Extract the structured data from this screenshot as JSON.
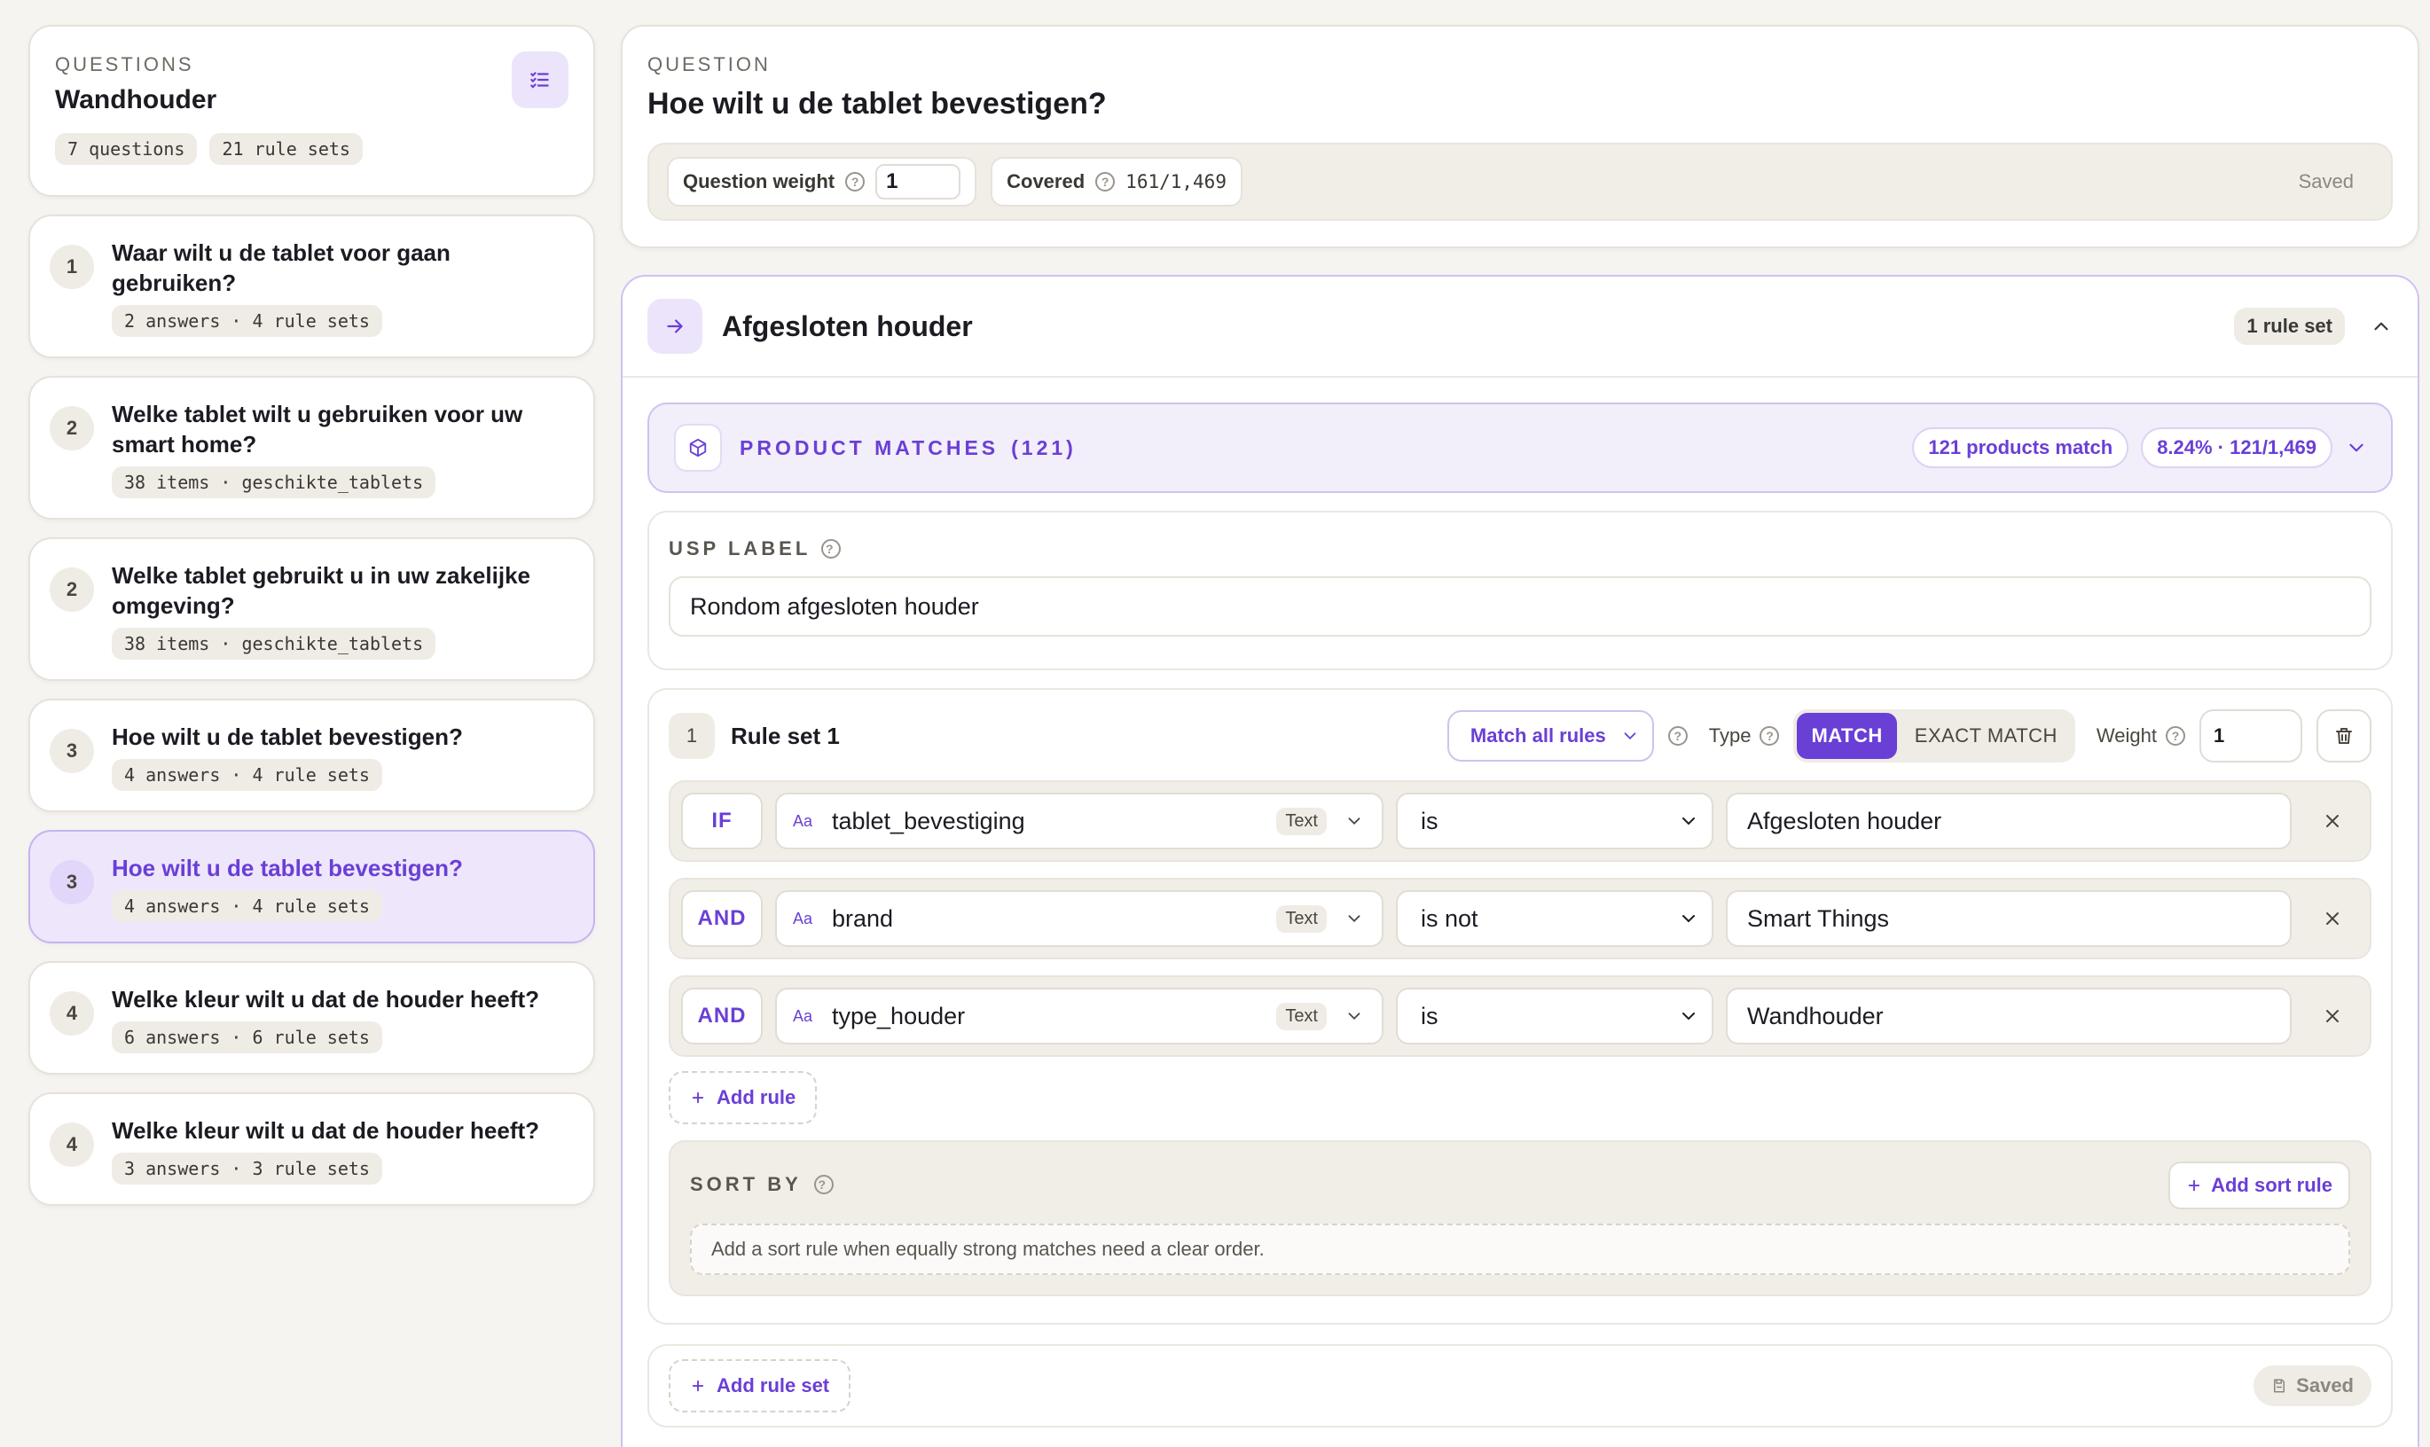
{
  "sidebar": {
    "eyebrow": "QUESTIONS",
    "title": "Wandhouder",
    "chips": [
      "7 questions",
      "21 rule sets"
    ],
    "filter_icon": "list-check-icon",
    "items": [
      {
        "num": "1",
        "text": "Waar wilt u de tablet voor gaan gebruiken?",
        "meta": "2 answers · 4 rule sets",
        "active": false
      },
      {
        "num": "2",
        "text": "Welke tablet wilt u gebruiken voor uw smart home?",
        "meta": "38 items · geschikte_tablets",
        "active": false
      },
      {
        "num": "2",
        "text": "Welke tablet gebruikt u in uw zakelijke omgeving?",
        "meta": "38 items · geschikte_tablets",
        "active": false
      },
      {
        "num": "3",
        "text": "Hoe wilt u de tablet bevestigen?",
        "meta": "4 answers · 4 rule sets",
        "active": false
      },
      {
        "num": "3",
        "text": "Hoe wilt u de tablet bevestigen?",
        "meta": "4 answers · 4 rule sets",
        "active": true
      },
      {
        "num": "4",
        "text": "Welke kleur wilt u dat de houder heeft?",
        "meta": "6 answers · 6 rule sets",
        "active": false
      },
      {
        "num": "4",
        "text": "Welke kleur wilt u dat de houder heeft?",
        "meta": "3 answers · 3 rule sets",
        "active": false
      }
    ]
  },
  "question": {
    "eyebrow": "QUESTION",
    "title": "Hoe wilt u de tablet bevestigen?",
    "weight_label": "Question weight",
    "weight_value": "1",
    "covered_label": "Covered",
    "covered_value": "161/1,469",
    "status": "Saved"
  },
  "answer": {
    "title": "Afgesloten houder",
    "ruleset_count": "1 rule set",
    "product_matches": {
      "label": "PRODUCT MATCHES",
      "count": "(121)",
      "match_chip": "121 products match",
      "pct_chip": "8.24% · 121/1,469"
    },
    "usp": {
      "label": "USP LABEL",
      "value": "Rondom afgesloten houder"
    },
    "ruleset": {
      "num": "1",
      "title": "Rule set 1",
      "match_mode": "Match all rules",
      "type_label": "Type",
      "type_options": [
        "MATCH",
        "EXACT MATCH"
      ],
      "type_selected": "MATCH",
      "weight_label": "Weight",
      "weight_value": "1",
      "rules": [
        {
          "op": "IF",
          "field": "tablet_bevestiging",
          "field_type": "Text",
          "condition": "is",
          "value": "Afgesloten houder"
        },
        {
          "op": "AND",
          "field": "brand",
          "field_type": "Text",
          "condition": "is not",
          "value": "Smart Things"
        },
        {
          "op": "AND",
          "field": "type_houder",
          "field_type": "Text",
          "condition": "is",
          "value": "Wandhouder"
        }
      ],
      "add_rule": "Add rule",
      "sort": {
        "label": "SORT BY",
        "add_label": "Add sort rule",
        "empty": "Add a sort rule when equally strong matches need a clear order."
      }
    },
    "add_ruleset": "Add rule set",
    "footer_status": "Saved"
  },
  "colors": {
    "accent": "#6a3fd6",
    "accent_soft": "#ece4fb",
    "background": "#f6f4f0"
  }
}
